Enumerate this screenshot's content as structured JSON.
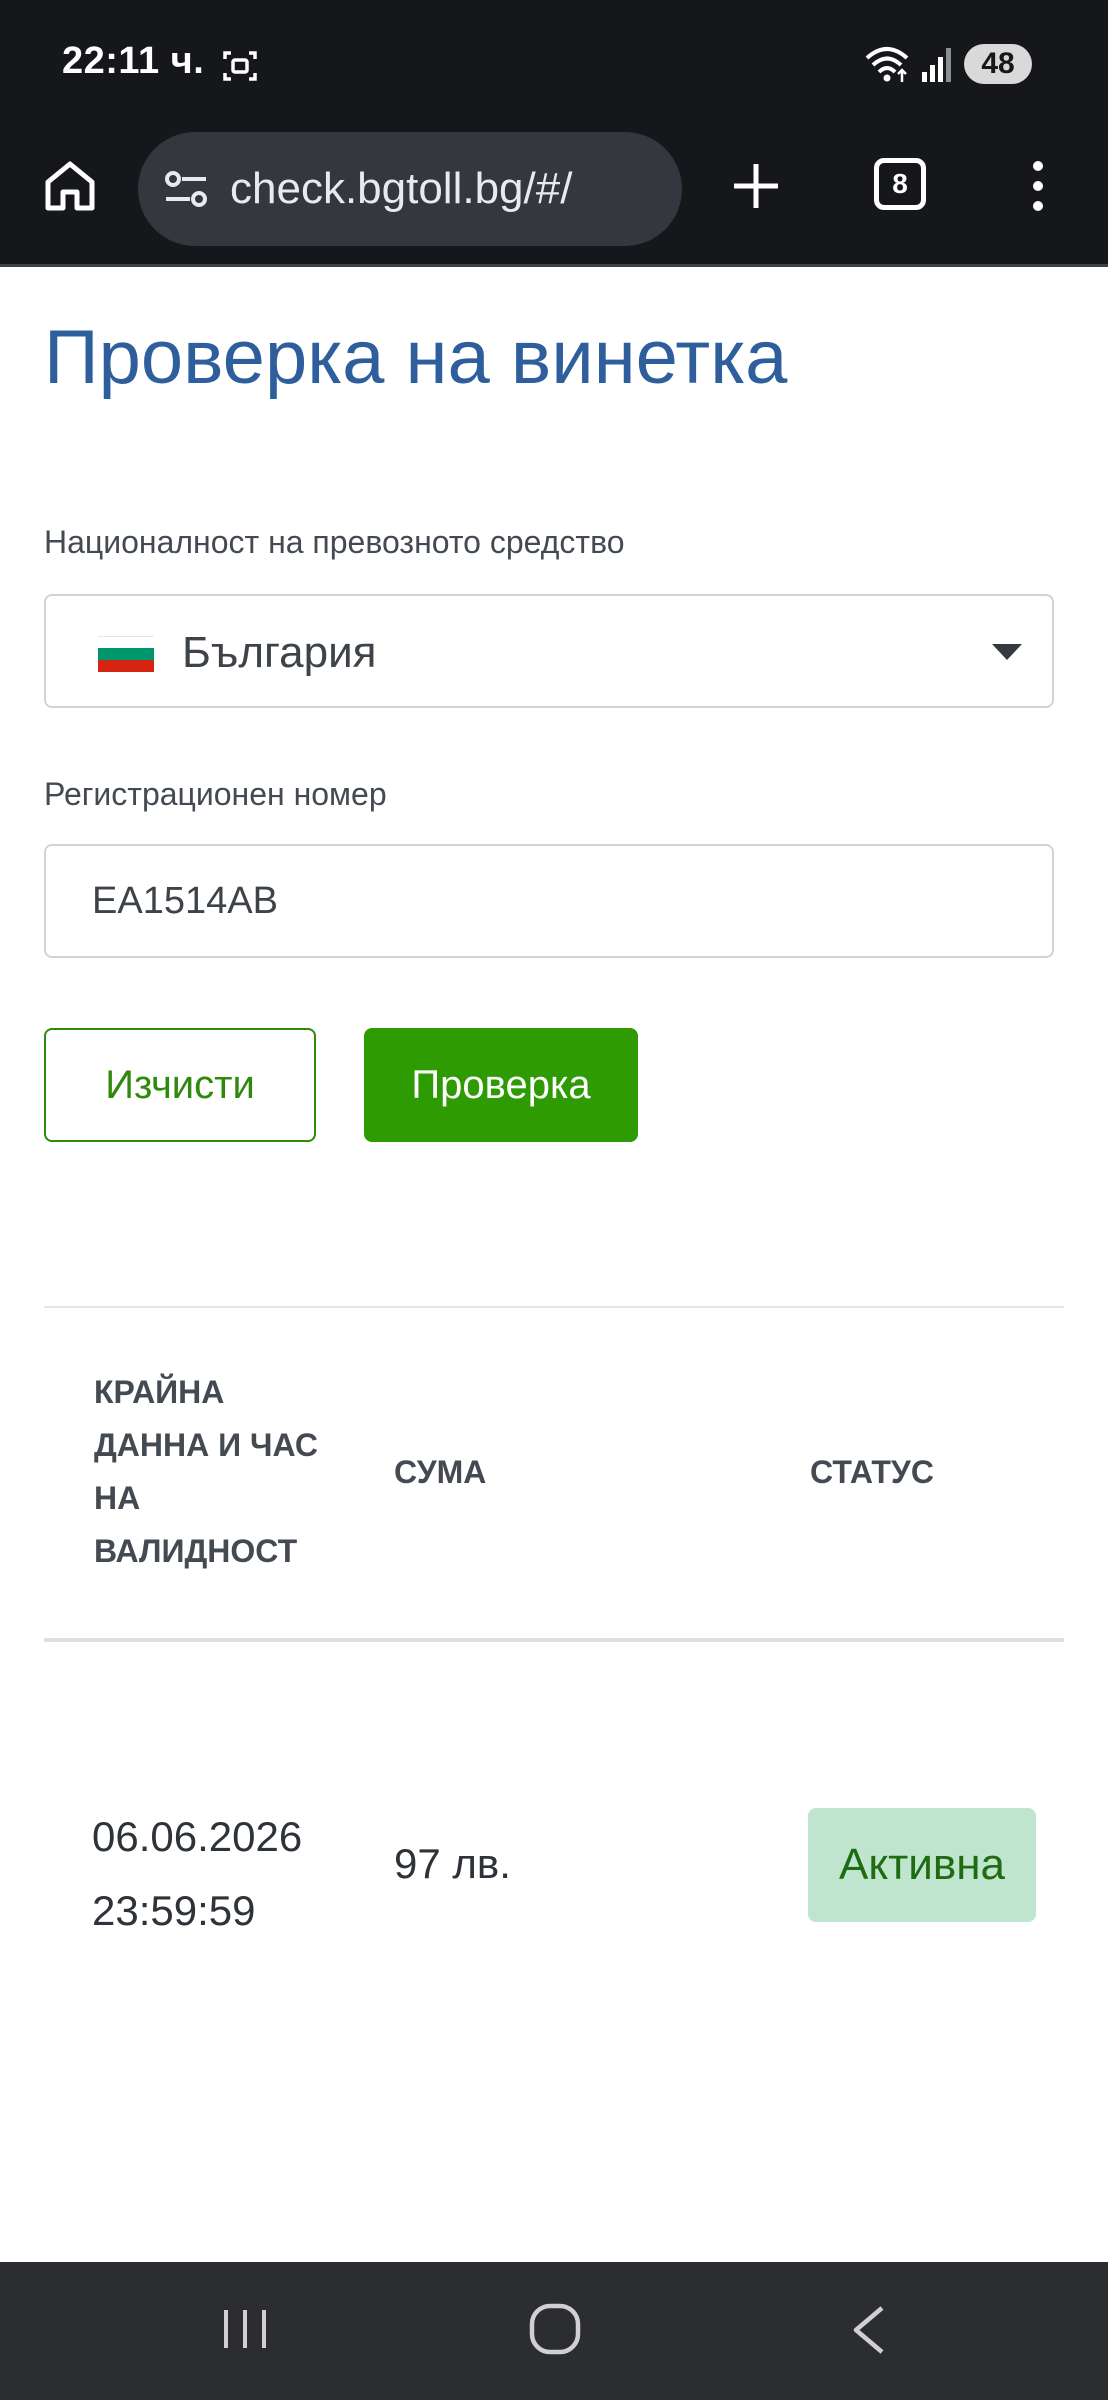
{
  "status_bar": {
    "time": "22:11 ч.",
    "battery": "48",
    "icons": [
      "screenshot-icon",
      "wifi-icon",
      "signal-icon"
    ]
  },
  "browser": {
    "url": "check.bgtoll.bg/#/",
    "tab_count": "8",
    "icons": [
      "home-icon",
      "site-settings-icon",
      "plus-icon",
      "tabs-icon",
      "more-vert-icon"
    ]
  },
  "page": {
    "title": "Проверка на винетка",
    "nationality": {
      "label": "Националност на превозното средство",
      "selected": "България",
      "flag_colors": [
        "#ffffff",
        "#00966e",
        "#d62612"
      ]
    },
    "registration": {
      "label": "Регистрационен номер",
      "value": "EA1514AB"
    },
    "buttons": {
      "clear": "Изчисти",
      "check": "Проверка"
    },
    "results": {
      "headers": {
        "validity": "КРАЙНА ДАННА И ЧАС НА ВАЛИДНОСТ",
        "amount": "СУМА",
        "status": "СТАТУС"
      },
      "rows": [
        {
          "date": "06.06.2026",
          "time": "23:59:59",
          "amount": "97 лв.",
          "status": "Активна"
        }
      ]
    },
    "colors": {
      "title": "#2e5f9c",
      "primary_button": "#2f9b02",
      "status_badge_bg": "#bfe5cf",
      "status_badge_text": "#1f6b12"
    }
  },
  "nav_bar": {
    "icons": [
      "recents-icon",
      "home-circle-icon",
      "back-icon"
    ]
  }
}
